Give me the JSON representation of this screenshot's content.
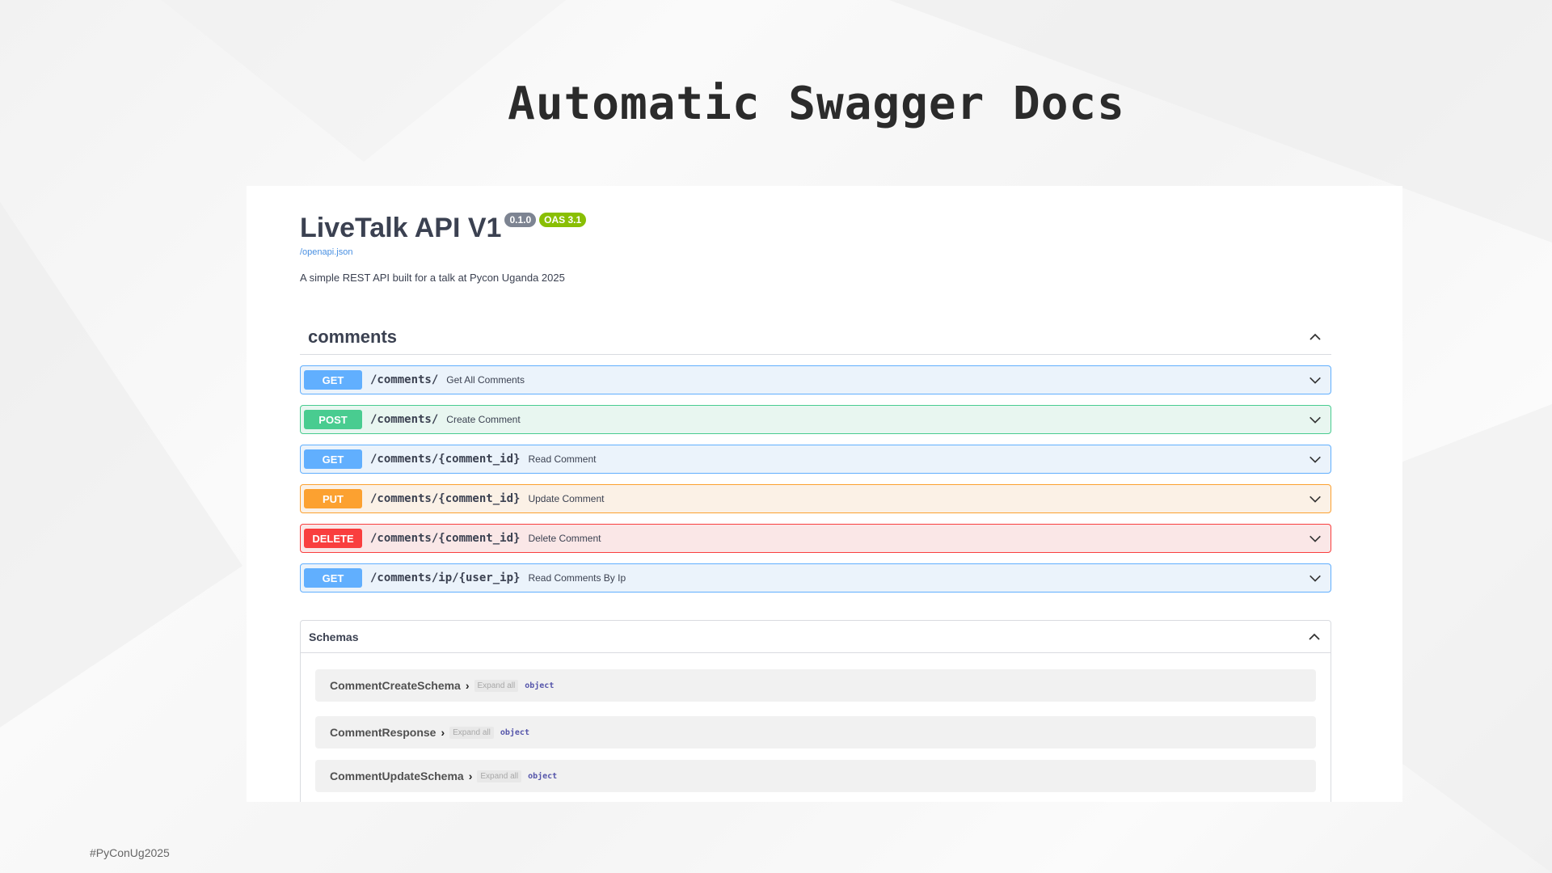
{
  "slide": {
    "title": "Automatic Swagger Docs",
    "footer": "#PyConUg2025"
  },
  "api": {
    "title": "LiveTalk API V1",
    "version": "0.1.0",
    "oas": "OAS 3.1",
    "spec_link": "/openapi.json",
    "description": "A simple REST API built for a talk at Pycon Uganda 2025"
  },
  "tag": {
    "name": "comments",
    "expanded": true
  },
  "operations": [
    {
      "method": "GET",
      "path": "/comments/",
      "summary": "Get All Comments"
    },
    {
      "method": "POST",
      "path": "/comments/",
      "summary": "Create Comment"
    },
    {
      "method": "GET",
      "path": "/comments/{comment_id}",
      "summary": "Read Comment"
    },
    {
      "method": "PUT",
      "path": "/comments/{comment_id}",
      "summary": "Update Comment"
    },
    {
      "method": "DELETE",
      "path": "/comments/{comment_id}",
      "summary": "Delete Comment"
    },
    {
      "method": "GET",
      "path": "/comments/ip/{user_ip}",
      "summary": "Read Comments By Ip"
    }
  ],
  "schemas": {
    "title": "Schemas",
    "items": [
      {
        "name": "CommentCreateSchema",
        "expand_label": "Expand all",
        "type": "object"
      },
      {
        "name": "CommentResponse",
        "expand_label": "Expand all",
        "type": "object"
      },
      {
        "name": "CommentUpdateSchema",
        "expand_label": "Expand all",
        "type": "object"
      }
    ]
  },
  "colors": {
    "get": "#61affe",
    "post": "#49cc90",
    "put": "#fca130",
    "delete": "#f93e3e"
  }
}
